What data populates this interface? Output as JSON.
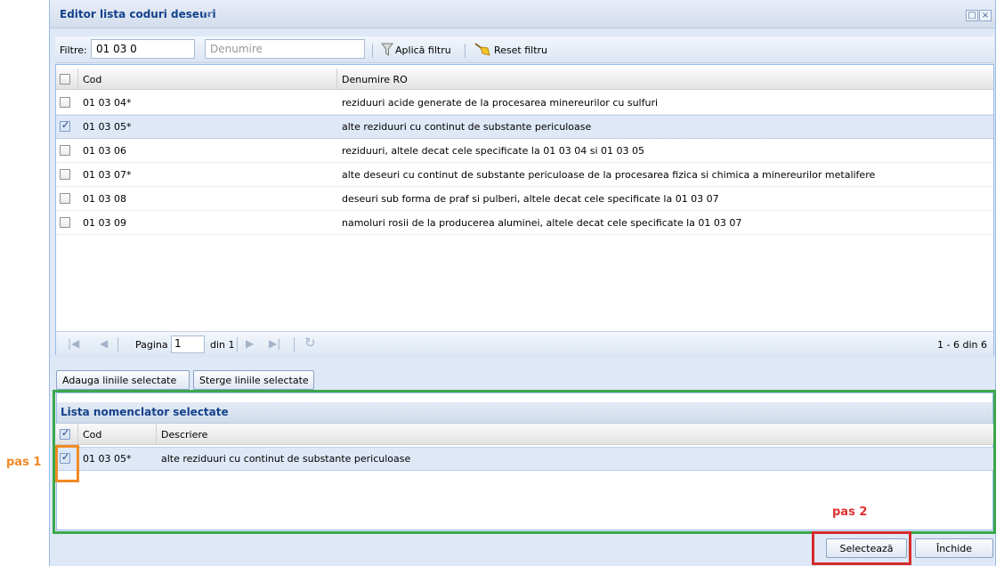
{
  "window": {
    "title": "Editor lista coduri deseuri",
    "title_ghost": "re",
    "controls": [
      "restore-icon",
      "close-icon"
    ]
  },
  "filter": {
    "label": "Filtre:",
    "cod_value": "01 03 0",
    "denumire_placeholder": "Denumire",
    "apply_label": "Aplică filtru",
    "reset_label": "Reset filtru"
  },
  "grid": {
    "columns": [
      "Cod",
      "Denumire RO"
    ],
    "rows": [
      {
        "cod": "01 03 04*",
        "denumire": "reziduuri acide generate de la procesarea minereurilor cu sulfuri",
        "checked": false
      },
      {
        "cod": "01 03 05*",
        "denumire": "alte reziduuri cu continut de substante periculoase",
        "checked": true
      },
      {
        "cod": "01 03 06",
        "denumire": "reziduuri, altele decat cele specificate la 01 03 04 si 01 03 05",
        "checked": false
      },
      {
        "cod": "01 03 07*",
        "denumire": "alte deseuri cu continut de substante periculoase de la procesarea fizica si chimica a minereurilor metalifere",
        "checked": false
      },
      {
        "cod": "01 03 08",
        "denumire": "deseuri sub forma de praf si pulberi, altele decat cele specificate la 01 03 07",
        "checked": false
      },
      {
        "cod": "01 03 09",
        "denumire": "namoluri rosii de la producerea aluminei, altele decat cele specificate la 01 03 07",
        "checked": false
      }
    ]
  },
  "pager": {
    "page_label": "Pagina",
    "page_value": "1",
    "of_label": "din 1",
    "summary": "1 - 6 din 6"
  },
  "actions": {
    "add_selected": "Adauga liniile selectate",
    "delete_selected": "Sterge liniile selectate"
  },
  "selected_panel": {
    "title": "Lista nomenclator selectate",
    "columns": [
      "Cod",
      "Descriere"
    ],
    "rows": [
      {
        "cod": "01 03 05*",
        "descriere": "alte reziduuri cu continut de substante periculoase",
        "checked": true
      }
    ]
  },
  "footer": {
    "select_label": "Selectează",
    "close_label": "Închide"
  },
  "annotations": {
    "step1": "pas 1",
    "step2": "pas 2",
    "colors": {
      "step1": "#f08a24",
      "step2": "#d52b2b",
      "panel": "#3aa84a"
    }
  }
}
